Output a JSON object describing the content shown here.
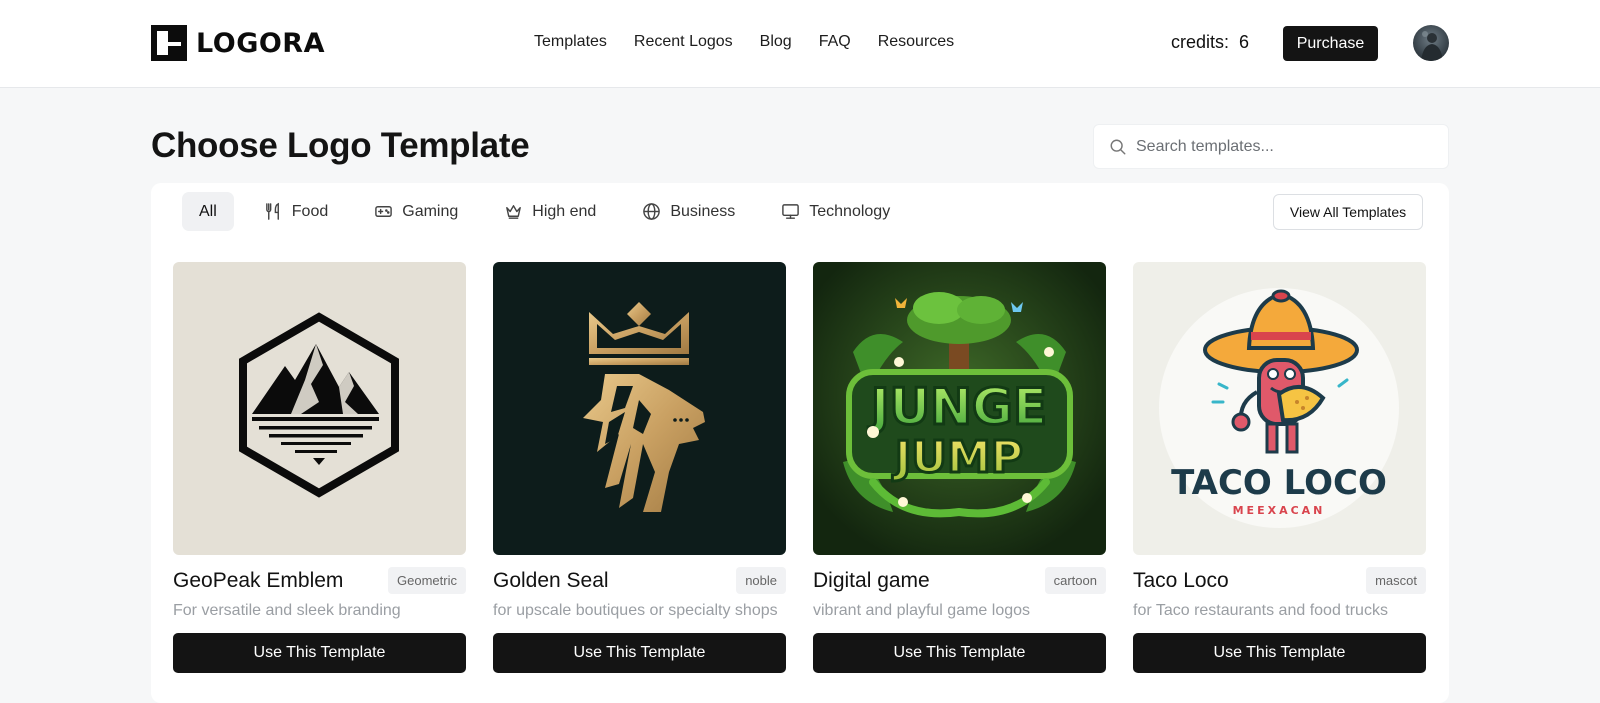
{
  "brand": {
    "name": "LOGORA"
  },
  "nav": [
    "Templates",
    "Recent Logos",
    "Blog",
    "FAQ",
    "Resources"
  ],
  "credits": {
    "label": "credits:",
    "value": "6"
  },
  "purchase_label": "Purchase",
  "page_title": "Choose Logo Template",
  "search": {
    "placeholder": "Search templates..."
  },
  "filters": [
    {
      "label": "All",
      "icon": "none",
      "active": true
    },
    {
      "label": "Food",
      "icon": "utensils-icon"
    },
    {
      "label": "Gaming",
      "icon": "gamepad-icon"
    },
    {
      "label": "High end",
      "icon": "crown-icon"
    },
    {
      "label": "Business",
      "icon": "globe-icon"
    },
    {
      "label": "Technology",
      "icon": "monitor-icon"
    }
  ],
  "view_all_label": "View All Templates",
  "use_label": "Use This Template",
  "cards": [
    {
      "name": "GeoPeak Emblem",
      "tag": "Geometric",
      "desc": "For versatile and sleek branding"
    },
    {
      "name": "Golden Seal",
      "tag": "noble",
      "desc": "for upscale boutiques or specialty shops"
    },
    {
      "name": "Digital game",
      "tag": "cartoon",
      "desc": "vibrant and playful game logos"
    },
    {
      "name": "Taco Loco",
      "tag": "mascot",
      "desc": "for Taco restaurants and food trucks",
      "logo_text": "TACO LOCO",
      "logo_subtext": "MEEXACAN"
    }
  ],
  "game_logo_text": {
    "line1": "JUNGE",
    "line2": "JUMP"
  }
}
